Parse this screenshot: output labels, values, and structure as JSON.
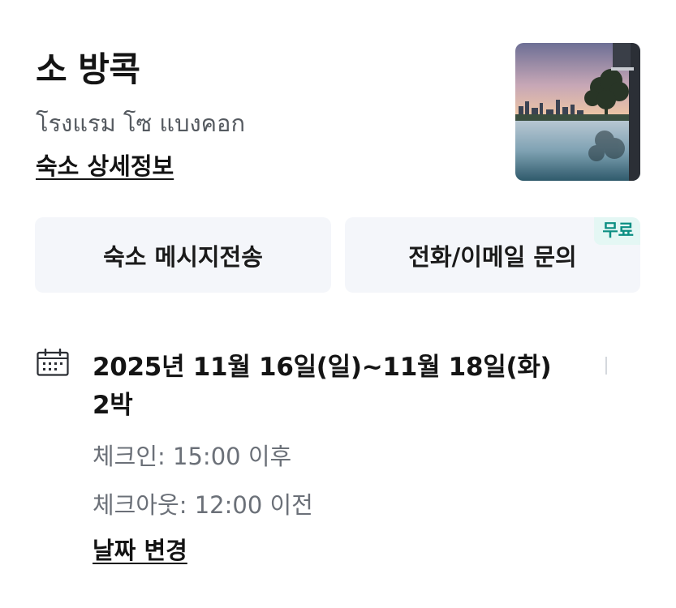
{
  "hotel": {
    "name": "소 방콕",
    "local_name": "โรงแรม โซ แบงคอก",
    "details_link": "숙소 상세정보",
    "thumbnail_alt": "호텔 이미지"
  },
  "actions": {
    "message_label": "숙소 메시지전송",
    "contact_label": "전화/이메일 문의",
    "contact_badge": "무료"
  },
  "stay": {
    "dates": "2025년 11월 16일(일)~11월 18일(화)",
    "nights": "2박",
    "checkin": "체크인: 15:00 이후",
    "checkout": "체크아웃: 12:00 이전",
    "change_link": "날짜 변경"
  },
  "colors": {
    "button_bg": "#f4f6fa",
    "badge_bg": "#e4f7f4",
    "badge_text": "#0c8f83",
    "muted_text": "#6b7078"
  },
  "icons": {
    "calendar": "calendar-icon"
  }
}
